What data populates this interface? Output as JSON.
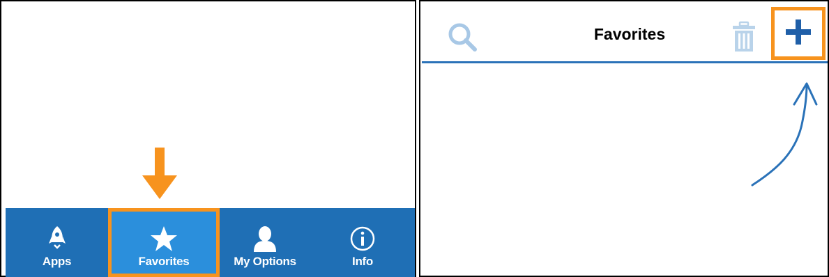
{
  "left": {
    "tabs": [
      {
        "id": "apps",
        "label": "Apps",
        "icon": "rocket-icon"
      },
      {
        "id": "favorites",
        "label": "Favorites",
        "icon": "star-icon",
        "selected": true
      },
      {
        "id": "my_options",
        "label": "My Options",
        "icon": "person-icon"
      },
      {
        "id": "info",
        "label": "Info",
        "icon": "info-icon"
      }
    ]
  },
  "right": {
    "header": {
      "title": "Favorites",
      "search_icon": "search-icon",
      "trash_icon": "trash-icon",
      "add_icon": "plus-icon"
    }
  },
  "colors": {
    "tab_bar": "#1f6fb5",
    "tab_selected": "#2b8fdc",
    "highlight": "#f7931e",
    "accent": "#2a72b8",
    "search_icon": "#a8c8e6",
    "trash_icon": "#b9d3ea"
  }
}
